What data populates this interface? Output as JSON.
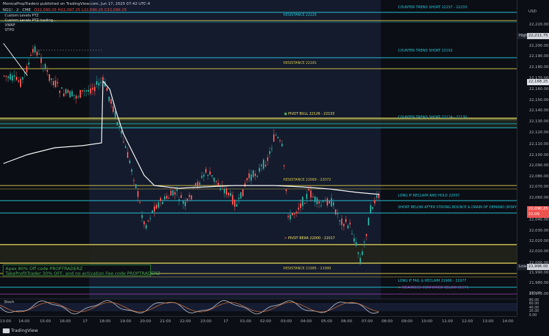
{
  "header": {
    "publisher": "MonicaPropTraderz published on TradingView.com, Jun 17, 2025 07:42 UTC-4",
    "symbol_line": "NQ1! · 2 · CME",
    "ohlc": "O22,090.25 H22,097.25 L22,090.25 C22,090.25",
    "currency": "USD",
    "indicators": [
      "Custom Levels PTZ",
      "Custom Levels PTZ loading...",
      "VWAP",
      "STPO"
    ]
  },
  "levels": [
    {
      "id": "ct-short-22237",
      "label": "COUNTER TREND SHORT 22237 - 22233",
      "color": "#26c6da"
    },
    {
      "id": "res-22225",
      "label": "RESISTANCE 22225",
      "color": "#26c6da"
    },
    {
      "id": "ct-short-22192",
      "label": "COUNTER TREND SHORT 22192",
      "color": "#26c6da"
    },
    {
      "id": "res-22181",
      "label": "RESISTANCE 22181",
      "color": "#d4c44a"
    },
    {
      "id": "pivot-bull",
      "label": "PIVOT BULL 22126 - 22133",
      "color": "#f5e663"
    },
    {
      "id": "ct-short-22124",
      "label": "COUNTER TREND SHORT 22124 - 22130",
      "color": "#26c6da"
    },
    {
      "id": "res-22069",
      "label": "RESISTANCE 22069 - 22072",
      "color": "#d4c44a"
    },
    {
      "id": "long-reclaim",
      "label": "LONG IF RECLAIM AND HOLD 22057",
      "color": "#26c6da"
    },
    {
      "id": "short-below",
      "label": "SHORT BELOW AFTER STRONG BOUNCE & DRAIN OF DEMAND (RISKY) 22046",
      "color": "#26c6da"
    },
    {
      "id": "pivot-bear",
      "label": "PIVOT BEAR 22000 - 22017",
      "color": "#f5e663"
    },
    {
      "id": "res-21985",
      "label": "RESISTANCE 21985 - 21989",
      "color": "#d4c44a"
    },
    {
      "id": "long-fail",
      "label": "LONG IF FAIL & RECLAIM 21966 - 21977",
      "color": "#26c6da"
    },
    {
      "id": "weakness",
      "label": "WEAKNESS CONFIRMED BELOW 21971",
      "color": "#ab47bc"
    }
  ],
  "price_axis": {
    "ticks": [
      "22,220.00",
      "22,210.00",
      "22,200.00",
      "22,190.00",
      "22,180.00",
      "22,170.00",
      "22,160.00",
      "22,150.00",
      "22,140.00",
      "22,130.00",
      "22,120.00",
      "22,110.00",
      "22,100.00",
      "22,090.00",
      "22,080.00",
      "22,070.00",
      "22,060.00",
      "22,050.00",
      "22,040.00",
      "22,030.00",
      "22,020.00",
      "22,010.00",
      "22,000.00",
      "21,990.00",
      "21,980.00",
      "21,970.00"
    ],
    "high_label": "High",
    "high_value": "22,211.75",
    "vwap_value": "22,168.25",
    "last_value": "22,090.25",
    "countdown": "21:09",
    "low_label": "Low",
    "low_value": "21,996.00",
    "stoch_ticks": [
      "100.00",
      "80.00",
      "60.00",
      "40.00",
      "20.00",
      "0.00"
    ]
  },
  "time_axis": [
    "13:00",
    "14:00",
    "15:00",
    "16:00",
    "17",
    "18:00",
    "19:00",
    "20:00",
    "21:00",
    "22:00",
    "23:00",
    "17",
    "01:00",
    "02:00",
    "03:00",
    "04:00",
    "05:00",
    "06:00",
    "07:00",
    "08:00",
    "09:00",
    "10:00",
    "11:00",
    "12:00",
    "13:00",
    "14:00"
  ],
  "stoch_label": "Stoch",
  "ad": {
    "line1": "Apex 80% Off code PROPTRADERZ",
    "line2": "TakeProfitTrader 30% OFF, and no activation Fee code PROPTRADERZ"
  },
  "footer": {
    "brand": "TradingView"
  }
}
